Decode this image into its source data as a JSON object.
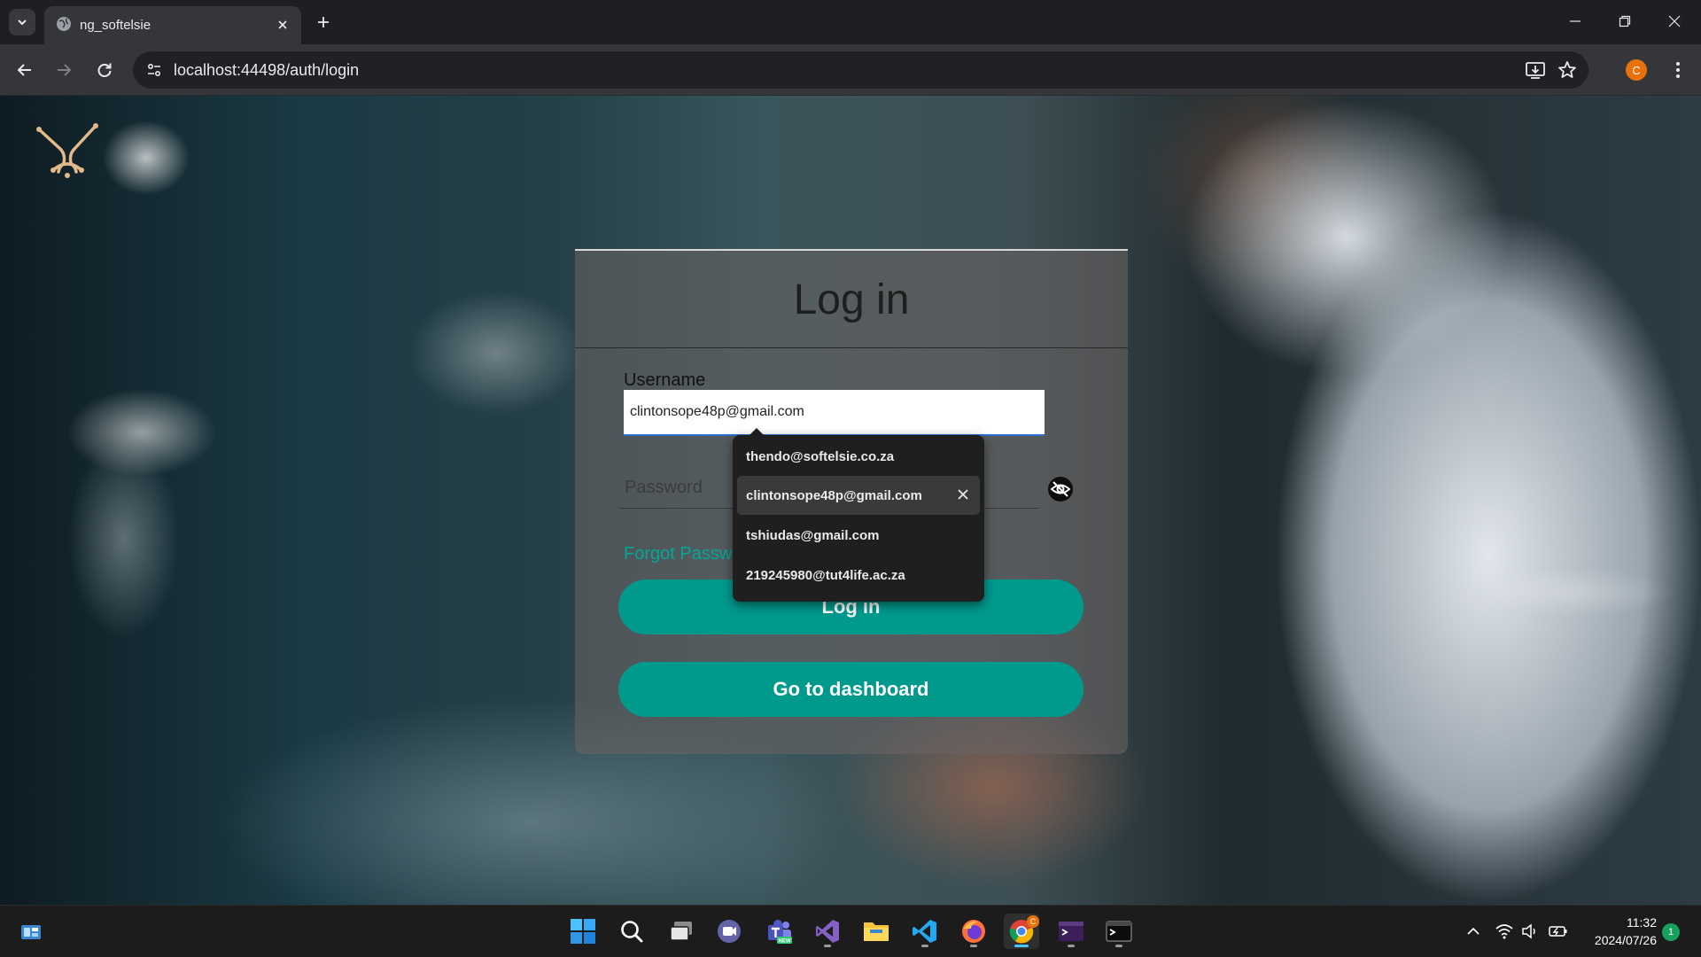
{
  "browser": {
    "tab_title": "ng_softelsie",
    "url": "localhost:44498/auth/login",
    "profile_initial": "C"
  },
  "page": {
    "heading": "Log in",
    "username_label": "Username",
    "username_value": "clintonsope48p@gmail.com",
    "password_placeholder": "Password",
    "forgot_password": "Forgot Password?",
    "login_button": "Log in",
    "dashboard_button": "Go to dashboard",
    "accent_color": "#009a8d"
  },
  "autofill": {
    "items": [
      {
        "label": "thendo@softelsie.co.za"
      },
      {
        "label": "clintonsope48p@gmail.com",
        "selected": true
      },
      {
        "label": "tshiudas@gmail.com"
      },
      {
        "label": "219245980@tut4life.ac.za"
      }
    ]
  },
  "taskbar": {
    "apps": [
      "start-icon",
      "search-icon",
      "task-view-icon",
      "teams-meet-icon",
      "teams-new-icon",
      "visual-studio-icon",
      "file-explorer-icon",
      "vscode-icon",
      "firefox-icon",
      "chrome-icon",
      "terminal-preview-icon",
      "terminal-icon"
    ],
    "chrome_badge": "C",
    "time": "11:32",
    "date": "2024/07/26",
    "notification_count": "1"
  }
}
